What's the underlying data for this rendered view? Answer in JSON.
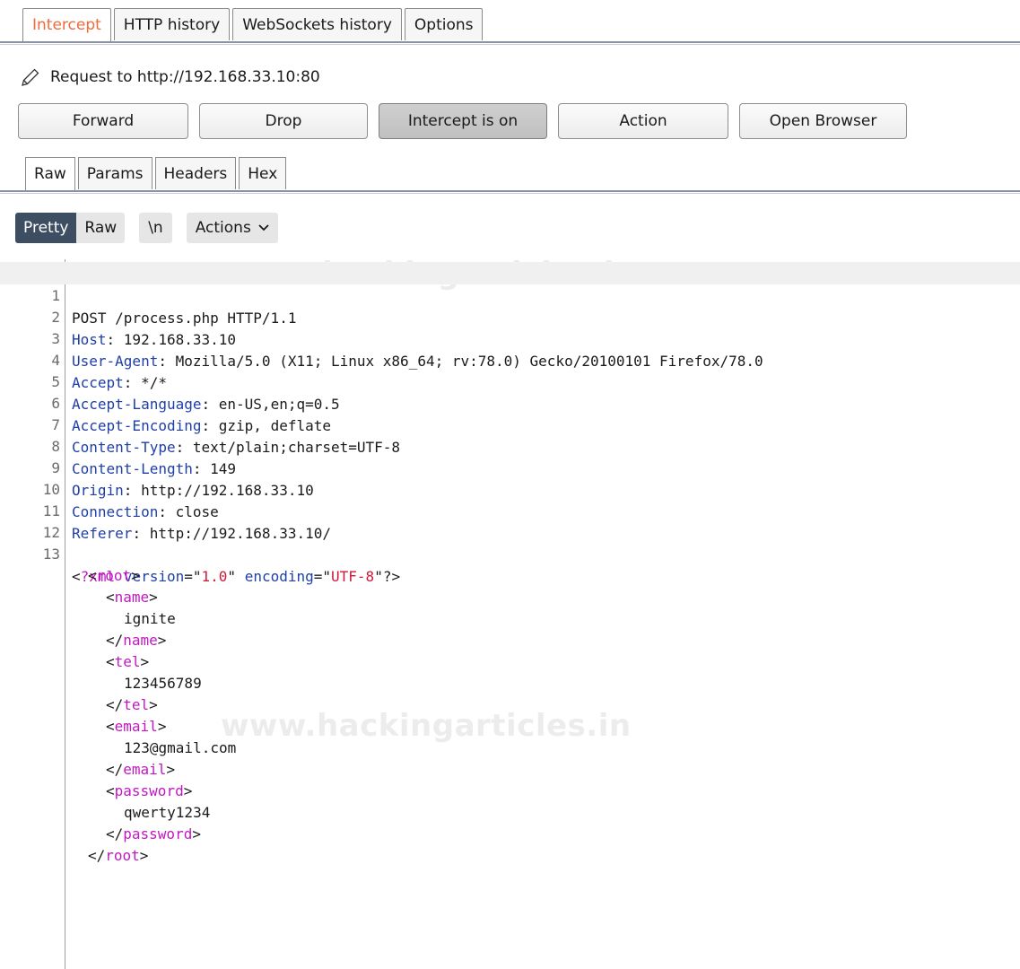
{
  "tabs": {
    "top": [
      "Intercept",
      "HTTP history",
      "WebSockets history",
      "Options"
    ],
    "active_top": "Intercept",
    "sub": [
      "Raw",
      "Params",
      "Headers",
      "Hex"
    ],
    "active_sub": "Raw"
  },
  "request": {
    "label": "Request to http://192.168.33.10:80"
  },
  "buttons": {
    "forward": "Forward",
    "drop": "Drop",
    "intercept": "Intercept is on",
    "action": "Action",
    "open_browser": "Open Browser"
  },
  "view": {
    "pretty": "Pretty",
    "raw": "Raw",
    "newline": "\\n",
    "actions": "Actions"
  },
  "watermark": "www.hackingarticles.in",
  "editor": {
    "request_line": "POST /process.php HTTP/1.1",
    "headers": [
      {
        "name": "Host",
        "value": "192.168.33.10"
      },
      {
        "name": "User-Agent",
        "value": "Mozilla/5.0 (X11; Linux x86_64; rv:78.0) Gecko/20100101 Firefox/78.0"
      },
      {
        "name": "Accept",
        "value": "*/*"
      },
      {
        "name": "Accept-Language",
        "value": "en-US,en;q=0.5"
      },
      {
        "name": "Accept-Encoding",
        "value": "gzip, deflate"
      },
      {
        "name": "Content-Type",
        "value": "text/plain;charset=UTF-8"
      },
      {
        "name": "Content-Length",
        "value": "149"
      },
      {
        "name": "Origin",
        "value": "http://192.168.33.10"
      },
      {
        "name": "Connection",
        "value": "close"
      },
      {
        "name": "Referer",
        "value": "http://192.168.33.10/"
      }
    ],
    "xml_decl": {
      "version": "1.0",
      "encoding": "UTF-8"
    },
    "root_tag": "root",
    "fields": [
      {
        "tag": "name",
        "value": "ignite"
      },
      {
        "tag": "tel",
        "value": "123456789"
      },
      {
        "tag": "email",
        "value": "123@gmail.com"
      },
      {
        "tag": "password",
        "value": "qwerty1234"
      }
    ],
    "line_numbers": [
      "1",
      "2",
      "3",
      "4",
      "5",
      "6",
      "7",
      "8",
      "9",
      "10",
      "11",
      "12",
      "13"
    ]
  },
  "colors": {
    "active_tab_text": "#f06a3a",
    "header_name": "#1f3fa8",
    "xml_tag": "#c218c2",
    "xml_value": "#d0193a",
    "pretty_bg": "#3d4e63"
  }
}
